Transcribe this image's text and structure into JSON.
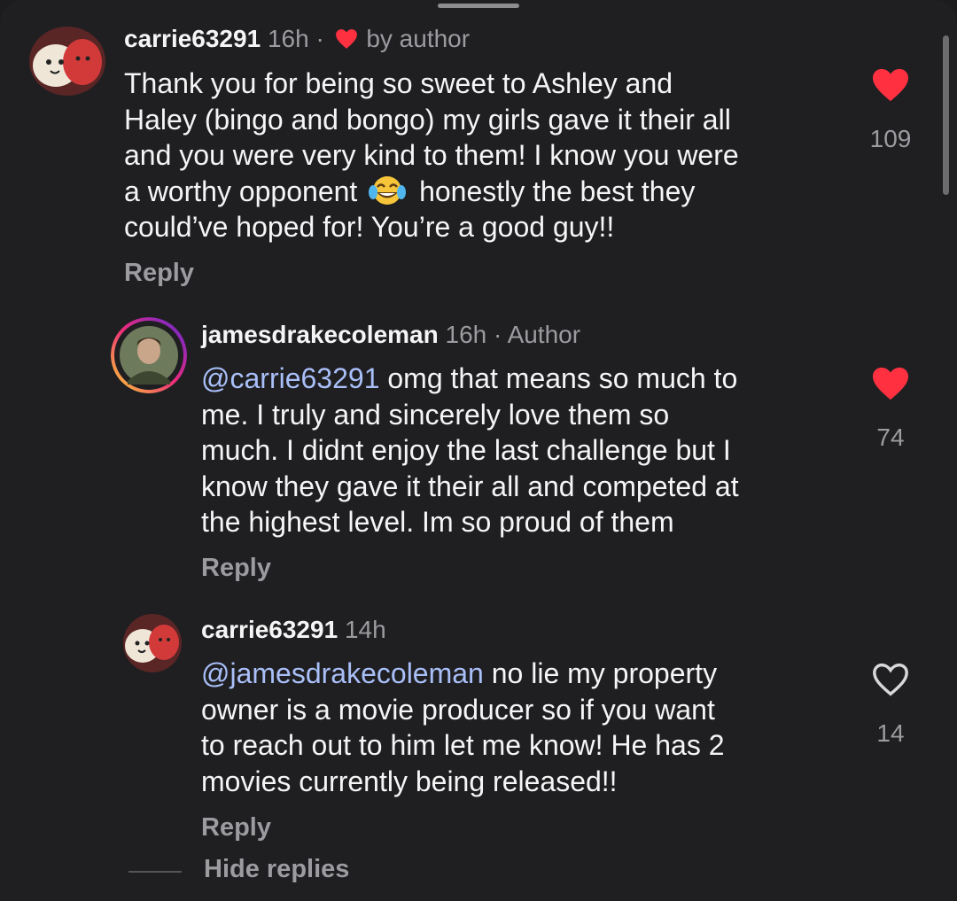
{
  "ui": {
    "hide_replies": "Hide replies"
  },
  "colors": {
    "background": "#1f1f22",
    "like_active": "#ff3040",
    "mention": "#a9bff8",
    "muted": "#9c9ca0"
  },
  "comments": [
    {
      "username": "carrie63291",
      "time": "16h",
      "separator": "·",
      "badge": "by author",
      "badge_icon": "heart-icon",
      "lines": [
        "Thank you for being so sweet to Ashley and",
        "Haley (bingo and bongo) my girls gave it their all",
        "and you were very kind to them! I know you were",
        "a worthy opponent",
        "honestly the best they",
        "could’ve hoped for! You’re a good guy!!"
      ],
      "emoji": "face-with-tears-of-joy-emoji",
      "reply_label": "Reply",
      "like_count": "109",
      "liked": true
    },
    {
      "username": "jamesdrakecoleman",
      "time": "16h",
      "separator": "·",
      "badge": "Author",
      "mention": "@carrie63291",
      "lines": [
        "omg that means so much to",
        "me. I truly and sincerely love them so",
        "much. I didnt enjoy the last challenge but I",
        "know they gave it their all and competed at",
        "the highest level. Im so proud of them"
      ],
      "reply_label": "Reply",
      "like_count": "74",
      "liked": true
    },
    {
      "username": "carrie63291",
      "time": "14h",
      "mention": "@jamesdrakecoleman",
      "lines": [
        "no lie my property",
        "owner is a movie producer so if you want",
        "to reach out to him let me know! He has 2",
        "movies currently being released!!"
      ],
      "reply_label": "Reply",
      "like_count": "14",
      "liked": false
    }
  ]
}
